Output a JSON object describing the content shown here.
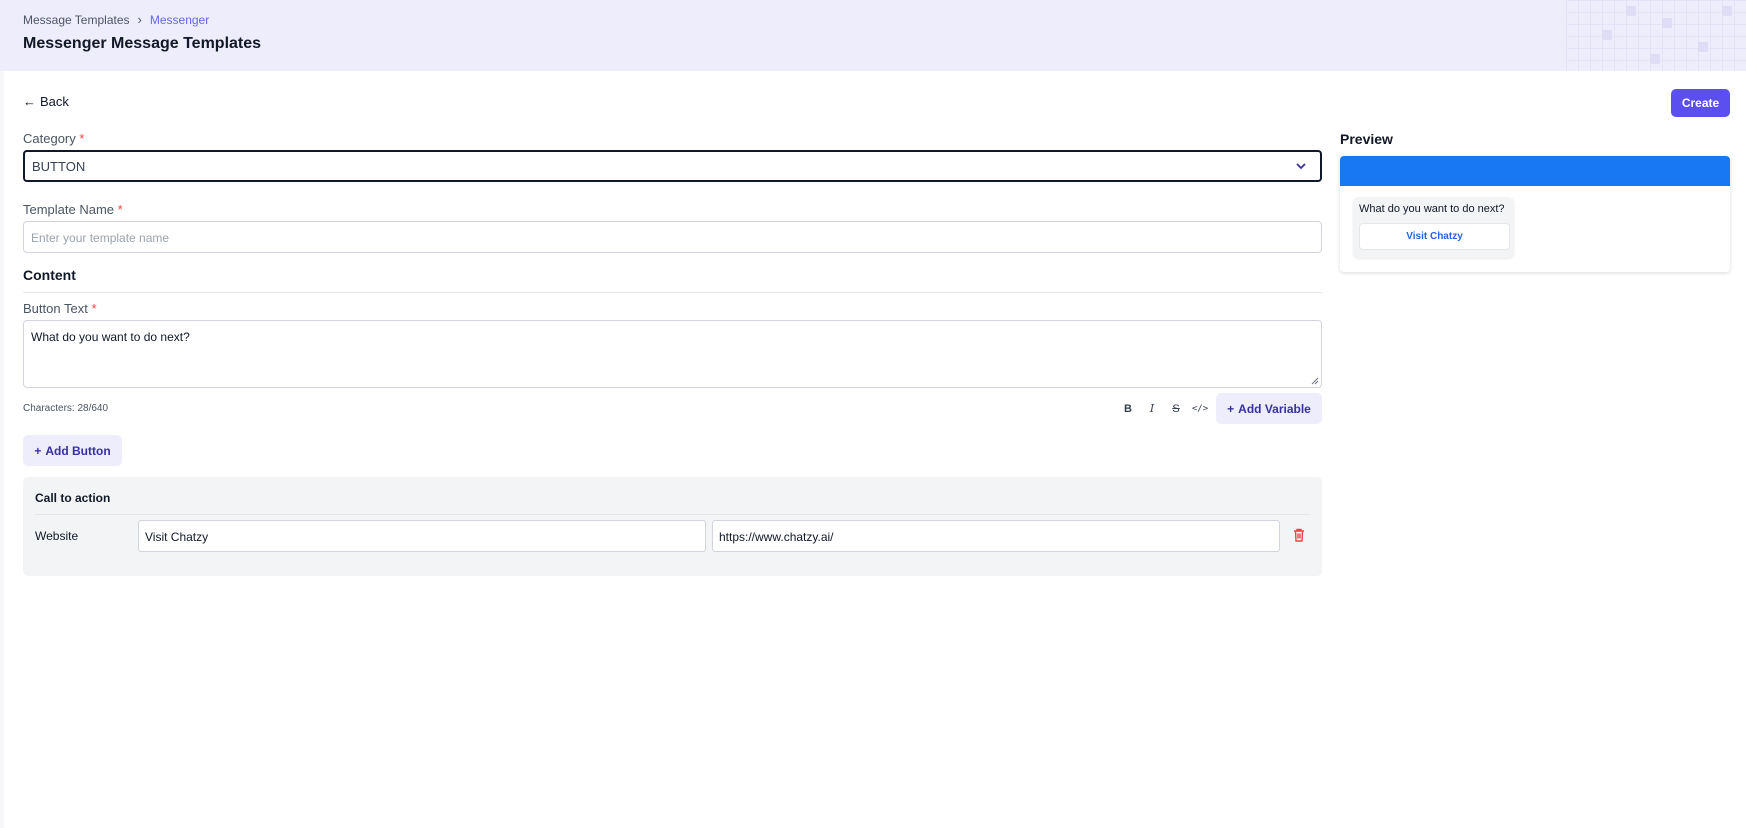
{
  "header": {
    "breadcrumb": [
      "Message Templates",
      "Messenger"
    ],
    "title": "Messenger Message Templates"
  },
  "actions": {
    "back_label": "Back",
    "create_label": "Create"
  },
  "form": {
    "category": {
      "label": "Category",
      "required_mark": "*",
      "value": "BUTTON"
    },
    "template_name": {
      "label": "Template Name",
      "required_mark": "*",
      "placeholder": "Enter your template name"
    },
    "content_title": "Content",
    "button_text": {
      "label": "Button Text",
      "required_mark": "*",
      "value": "What do you want to do next?"
    },
    "char_count": "Characters: 28/640",
    "format_tools": [
      {
        "icon": "bold-icon",
        "glyph": "B"
      },
      {
        "icon": "italic-icon",
        "glyph": "I"
      },
      {
        "icon": "strikethrough-icon",
        "glyph": "S"
      },
      {
        "icon": "code-icon",
        "glyph": "</>"
      }
    ],
    "add_variable_label": "Add Variable",
    "add_button_label": "Add Button"
  },
  "call_to_action": {
    "title": "Call to action",
    "rows": [
      {
        "type": "Website",
        "button_text": "Visit Chatzy",
        "url": "https://www.chatzy.ai/"
      }
    ]
  },
  "preview": {
    "title": "Preview",
    "message": "What do you want to do next?",
    "button_label": "Visit Chatzy",
    "header_color": "#1877f2"
  },
  "colors": {
    "accent": "#5b4ff0",
    "topbar": "#eeedfc",
    "required": "#ef4444",
    "delete": "#ef4444"
  }
}
